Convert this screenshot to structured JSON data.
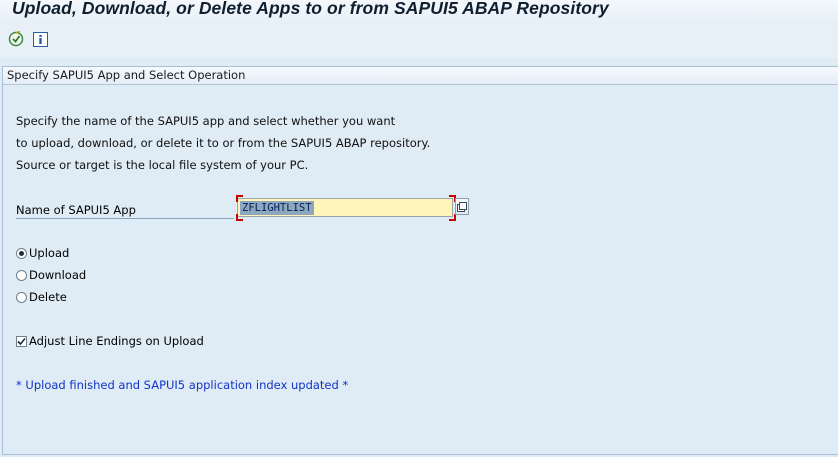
{
  "window": {
    "title": "Upload, Download, or Delete Apps to or from SAPUI5 ABAP Repository"
  },
  "toolbar": {
    "execute_icon": "execute-icon",
    "info_icon": "info-icon"
  },
  "panel": {
    "header": "Specify SAPUI5 App and Select Operation",
    "intro_lines": [
      "Specify the name of the SAPUI5 app and select whether you want",
      "to upload, download, or delete it to or from the SAPUI5 ABAP repository.",
      "Source or target is the local file system of your PC."
    ],
    "app_field": {
      "label": "Name of SAPUI5 App",
      "value": "ZFLIGHTLIST"
    },
    "operations": [
      {
        "label": "Upload",
        "selected": true
      },
      {
        "label": "Download",
        "selected": false
      },
      {
        "label": "Delete",
        "selected": false
      }
    ],
    "adjust_line_endings": {
      "label": "Adjust Line Endings on Upload",
      "checked": true
    },
    "status_message": "* Upload finished and SAPUI5 application index updated *"
  },
  "colors": {
    "background": "#dfebf5",
    "input_highlight": "#fff5b8",
    "message": "#1034c8",
    "required_marker": "#c80000"
  }
}
